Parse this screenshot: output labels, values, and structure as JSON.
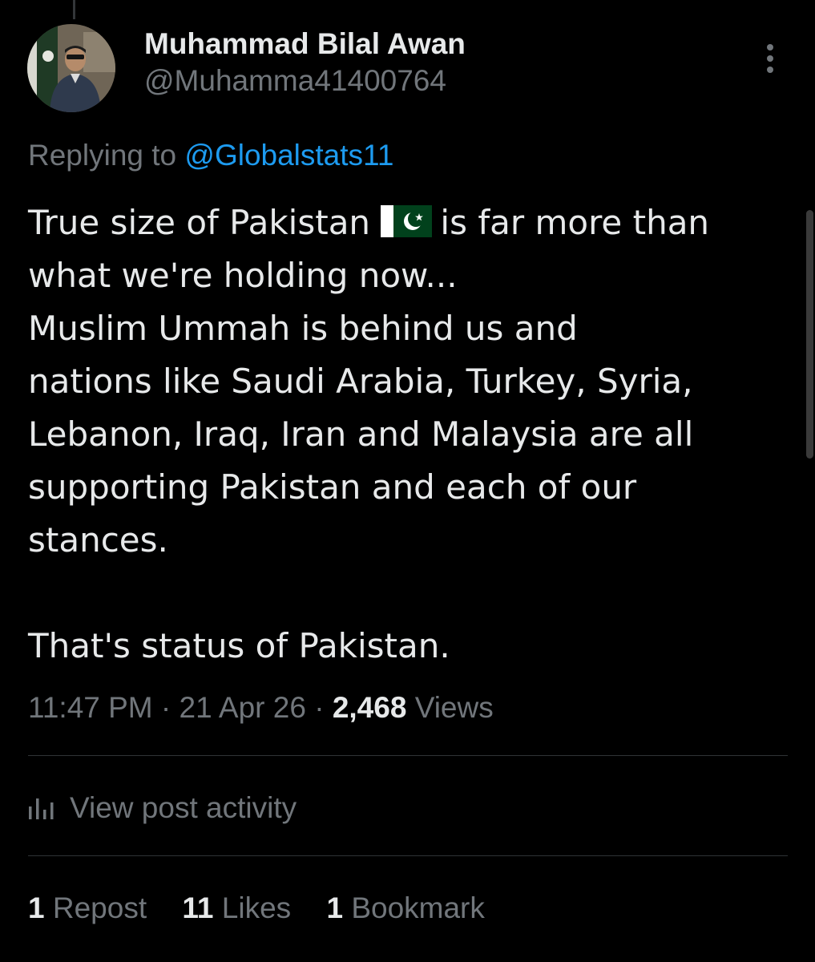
{
  "author": {
    "display_name": "Muhammad Bilal Awan",
    "handle": "@Muhamma41400764"
  },
  "reply": {
    "prefix": "Replying to",
    "mention": "@Globalstats11"
  },
  "tweet": {
    "line1_before_flag": "True size of Pakistan",
    "line1_after_flag": "is far more than",
    "flag_icon": "pakistan-flag-emoji",
    "lines": [
      "what we're holding now...",
      "Muslim Ummah is behind us and",
      "nations like Saudi Arabia, Turkey, Syria,",
      "Lebanon, Iraq, Iran and Malaysia are all",
      "supporting Pakistan and each of our",
      "stances."
    ],
    "closing": "That's status of Pakistan."
  },
  "meta": {
    "time": "11:47 PM",
    "sep1": " · ",
    "date": "21 Apr 26",
    "sep2": " · ",
    "views_count": "2,468",
    "views_label": "Views"
  },
  "activity": {
    "label": "View post activity",
    "icon": "bar-chart-icon"
  },
  "stats": {
    "reposts_count": "1",
    "reposts_label": "Repost",
    "likes_count": "11",
    "likes_label": "Likes",
    "bookmarks_count": "1",
    "bookmarks_label": "Bookmark"
  },
  "colors": {
    "background": "#000000",
    "text": "#e7e9ea",
    "secondary": "#71767b",
    "accent": "#1d9bf0",
    "divider": "#2f3336",
    "flag_green": "#01411c"
  }
}
